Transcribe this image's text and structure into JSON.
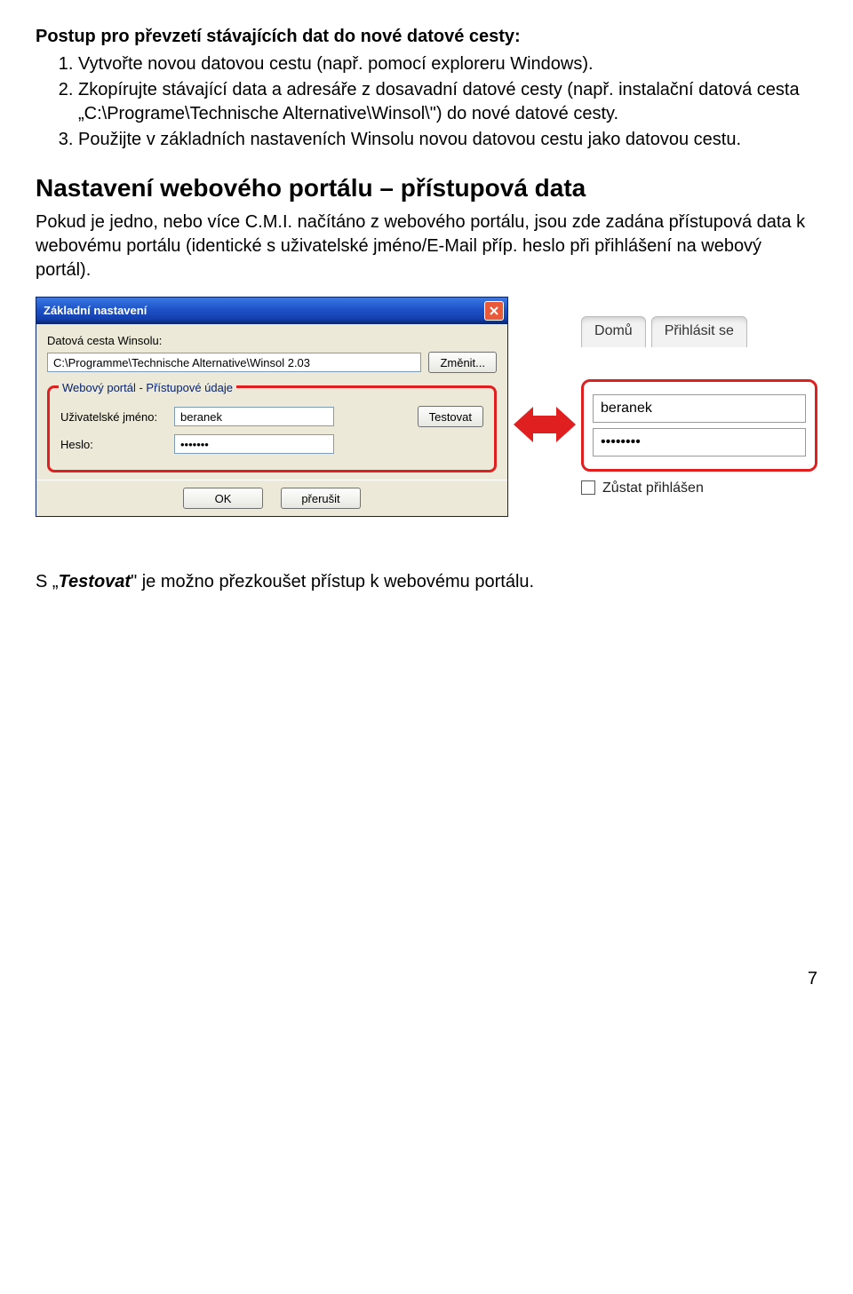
{
  "intro_heading": "Postup pro převzetí stávajících dat do nové datové cesty:",
  "steps": [
    "Vytvořte novou datovou cestu (např. pomocí exploreru Windows).",
    "Zkopírujte stávající data a adresáře z dosavadní datové cesty (např. instalační datová cesta „C:\\Programe\\Technische Alternative\\Winsol\\\") do nové datové cesty.",
    "Použijte v základních nastaveních Winsolu novou datovou cestu jako datovou cestu."
  ],
  "section_title": "Nastavení webového portálu – přístupová data",
  "section_para": "Pokud je jedno, nebo více C.M.I. načítáno z webového portálu, jsou zde zadána přístupová data k webovému portálu (identické s uživatelské jméno/E-Mail příp. heslo při přihlášení na webový portál).",
  "dialog": {
    "title": "Základní nastavení",
    "path_label": "Datová cesta Winsolu:",
    "path_value": "C:\\Programme\\Technische Alternative\\Winsol 2.03",
    "change_btn": "Změnit...",
    "group_title": "Webový portál - Přístupové údaje",
    "user_label": "Uživatelské jméno:",
    "user_value": "beranek",
    "pass_label": "Heslo:",
    "pass_value": "•••••••",
    "test_btn": "Testovat",
    "ok_btn": "OK",
    "cancel_btn": "přerušit"
  },
  "portal": {
    "tab_home": "Domů",
    "tab_login": "Přihlásit se",
    "user_value": "beranek",
    "pass_value": "••••••••",
    "remember": "Zůstat přihlášen"
  },
  "footer_sentence_prefix": "S „",
  "footer_bold": "Testovat",
  "footer_sentence_suffix": "\" je možno přezkoušet přístup k webovému portálu.",
  "page_number": "7"
}
